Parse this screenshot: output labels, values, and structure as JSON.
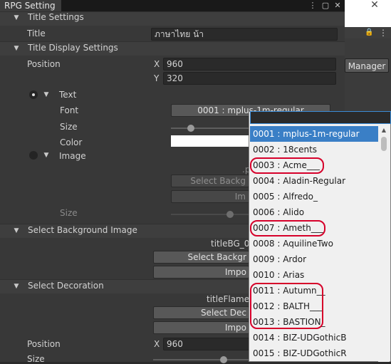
{
  "window": {
    "tab_title": "RPG Setting"
  },
  "right_pane": {
    "close_glyph": "✕",
    "manager_label": "Manager"
  },
  "sections": {
    "title_settings": "Title Settings",
    "title_display": "Title Display Settings",
    "bg_image": "Select Background Image",
    "decoration": "Select Decoration"
  },
  "fields": {
    "title_label": "Title",
    "title_value": "ภาษาไทย น้า",
    "position_label": "Position",
    "x_label": "X",
    "x_value": "960",
    "y_label": "Y",
    "y_value": "320",
    "text_label": "Text",
    "font_label": "Font",
    "font_value": "0001 : mplus-1m-regular",
    "size_label": "Size",
    "color_label": "Color",
    "image_label": "Image",
    "img_path_partial": ".p",
    "img_select_btn": "Select Backg",
    "img_btn2": "Im",
    "size2_label": "Size",
    "bg_filename": "titleBG_0",
    "bg_select_btn": "Select Backgr",
    "bg_import_btn": "Impo",
    "deco_filename": "titleFlame_",
    "deco_select_btn": "Select Dec",
    "deco_import_btn": "Impo",
    "deco_position_label": "Position",
    "deco_x_label": "X",
    "deco_x_value": "960",
    "deco_size_label": "Size"
  },
  "dropdown": {
    "search_value": "",
    "items": [
      "0001 : mplus-1m-regular",
      "0002 : 18cents",
      "0003 : Acme___",
      "0004 : Aladin-Regular",
      "0005 : Alfredo_",
      "0006 : Alido",
      "0007 : Ameth___",
      "0008 : AquilineTwo",
      "0009 : Ardor",
      "0010 : Arias",
      "0011 : Autumn__",
      "0012 : BALTH___",
      "0013 : BASTION_",
      "0014 : BIZ-UDGothicB",
      "0015 : BIZ-UDGothicR"
    ],
    "selected_index": 0,
    "highlight_color": "#d6002a",
    "selected_color": "#3a7fc6"
  },
  "icons": {
    "menu": "more-vertical-icon",
    "maximize": "maximize-icon",
    "close": "close-icon",
    "lock": "lock-icon",
    "foldout": "triangle-down-icon"
  }
}
